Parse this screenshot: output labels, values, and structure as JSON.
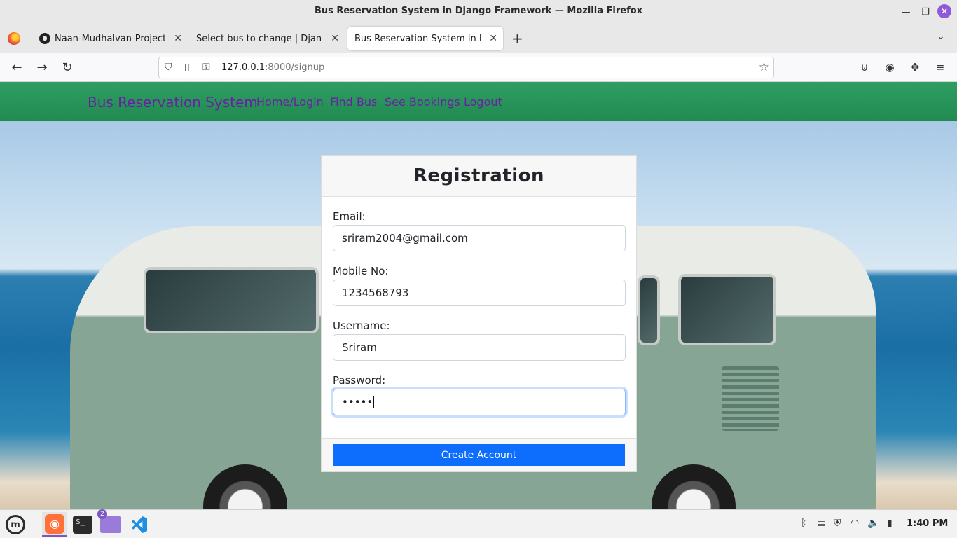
{
  "window": {
    "title": "Bus Reservation System in Django Framework — Mozilla Firefox",
    "min_glyph": "—",
    "max_glyph": "❐",
    "close_glyph": "✕"
  },
  "tabs": [
    {
      "label": "Naan-Mudhalvan-Project/Bus",
      "icon": "github-icon",
      "close": "✕"
    },
    {
      "label": "Select bus to change | Django site",
      "icon": "none",
      "close": "✕"
    },
    {
      "label": "Bus Reservation System in Django",
      "icon": "none",
      "close": "✕",
      "active": true
    }
  ],
  "tabstrip": {
    "new_tab": "+",
    "list_all": "⌄"
  },
  "toolbar": {
    "back": "←",
    "forward": "→",
    "reload": "↻",
    "url_host": "127.0.0.1",
    "url_rest": ":8000/signup",
    "shield": "⛉",
    "page": "▯",
    "key": "⚿",
    "bookmark_star": "☆",
    "pocket": "⊍",
    "account": "◉",
    "extensions": "✥",
    "menu": "≡"
  },
  "site": {
    "brand": "Bus Reservation System",
    "nav": [
      "Home/Login",
      "Find Bus",
      "See Bookings",
      "Logout"
    ],
    "colors": {
      "header": "#2f9e63",
      "link": "#6b1fa5",
      "button": "#0d6efd"
    }
  },
  "form": {
    "title": "Registration",
    "email_label": "Email:",
    "email_value": "sriram2004@gmail.com",
    "mobile_label": "Mobile No:",
    "mobile_value": "1234568793",
    "username_label": "Username:",
    "username_value": "Sriram",
    "password_label": "Password:",
    "password_value": "•••••",
    "submit_label": "Create Account"
  },
  "taskbar": {
    "menu_glyph": "m",
    "firefox_glyph": "◉",
    "terminal_glyph": "$_",
    "files_badge": "2",
    "tray": {
      "bluetooth": "ᛒ",
      "clipboard": "▤",
      "shield": "⛨",
      "wifi": "◠",
      "volume": "🔈",
      "battery": "▮"
    },
    "clock": "1:40 PM"
  }
}
